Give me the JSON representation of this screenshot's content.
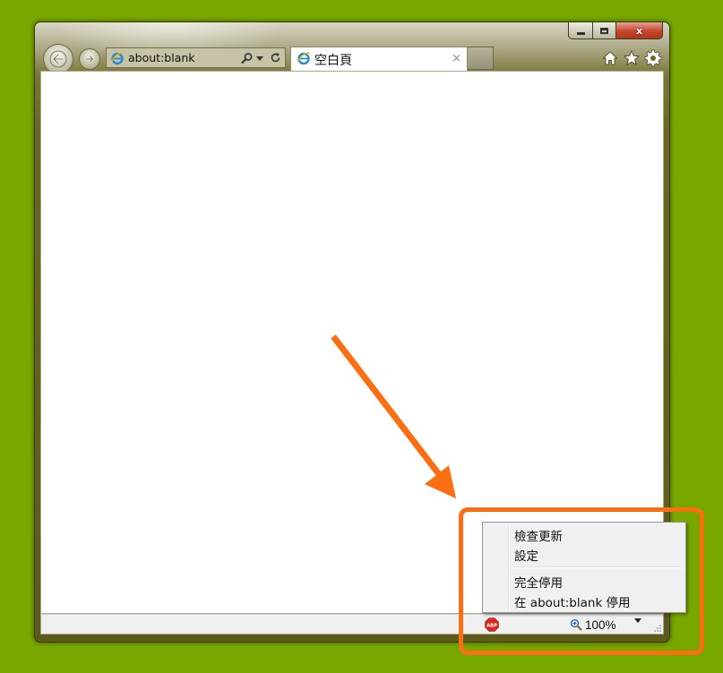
{
  "browser": {
    "address": "about:blank",
    "active_tab_title": "空白頁",
    "tab_close_glyph": "×",
    "close_glyph": "x"
  },
  "context_menu": {
    "items": [
      {
        "label": "檢查更新"
      },
      {
        "label": "設定"
      },
      {
        "label": "完全停用"
      },
      {
        "label": "在 about:blank 停用"
      }
    ]
  },
  "status_bar": {
    "zoom_level": "100%",
    "abp_label": "ABP"
  },
  "colors": {
    "desktop_background": "#78a800",
    "annotation_orange": "#fb6e12",
    "window_frame": "#6a6726",
    "close_button": "#c7442d"
  },
  "icons": {
    "back": "back-arrow-icon",
    "forward": "forward-arrow-icon",
    "search": "search-icon",
    "refresh": "refresh-icon",
    "home": "home-icon",
    "favorites": "star-icon",
    "tools": "gear-icon",
    "zoom": "magnifier-icon",
    "adblock": "abp-icon"
  }
}
